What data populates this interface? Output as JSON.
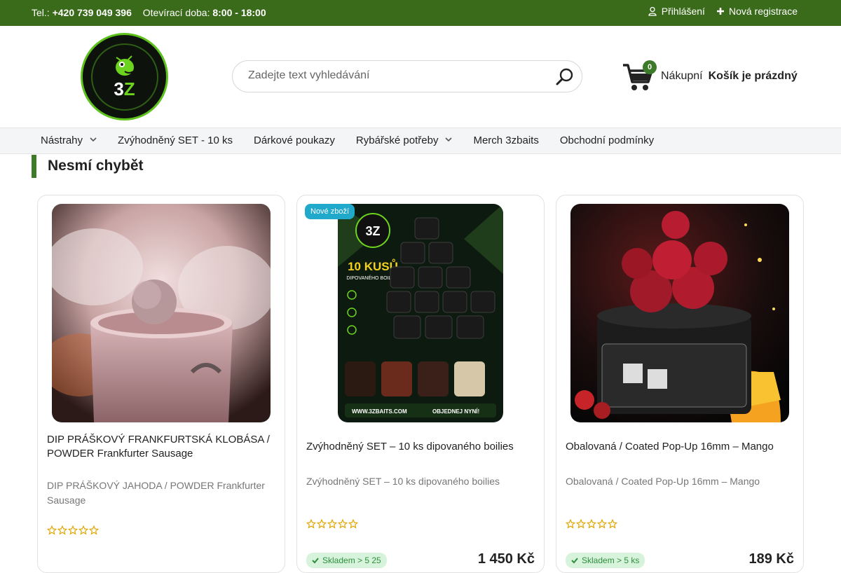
{
  "topbar": {
    "phone_label": "Tel.:",
    "phone": "+420 739 049 396",
    "hours_label": "Otevírací doba:",
    "hours": "8:00 - 18:00",
    "login": "Přihlášení",
    "register": "Nová registrace"
  },
  "header": {
    "logo_text_prefix": "3",
    "logo_text_accent": "Z",
    "search_placeholder": "Zadejte text vyhledávání",
    "cart_count": "0",
    "cart_label": "Nákupní",
    "cart_status": "Košík je prázdný"
  },
  "nav": {
    "items": [
      {
        "label": "Nástrahy",
        "dropdown": true
      },
      {
        "label": "Zvýhodněný SET - 10 ks",
        "dropdown": false
      },
      {
        "label": "Dárkové poukazy",
        "dropdown": false
      },
      {
        "label": "Rybářské potřeby",
        "dropdown": true
      },
      {
        "label": "Merch 3zbaits",
        "dropdown": false
      },
      {
        "label": "Obchodní podmínky",
        "dropdown": false
      }
    ]
  },
  "section": {
    "title": "Nesmí chybět"
  },
  "products": [
    {
      "title": "DIP PRÁŠKOVÝ FRANKFURTSKÁ KLOBÁSA / POWDER Frankfurter Sausage",
      "desc": "DIP PRÁŠKOVÝ JAHODA / POWDER Frankfurter Sausage",
      "badge": "",
      "stock": "",
      "price": "",
      "rating": 0
    },
    {
      "title": "Zvýhodněný SET – 10 ks dipovaného boilies",
      "desc": "Zvýhodněný SET – 10 ks dipovaného boilies",
      "badge": "Nové zboží",
      "stock": "Skladem > 5 25",
      "price": "1 450 Kč",
      "rating": 0,
      "poster_headline": "10 KUSŮ",
      "poster_sub": "DIPOVANÉHO BOILIES",
      "poster_url": "WWW.3ZBAITS.COM",
      "poster_cta": "OBJEDNEJ NYNÍ!"
    },
    {
      "title": "Obalovaná / Coated Pop-Up 16mm – Mango",
      "desc": "Obalovaná / Coated Pop-Up 16mm – Mango",
      "badge": "",
      "stock": "Skladem > 5 ks",
      "price": "189 Kč",
      "rating": 0
    }
  ],
  "colors": {
    "topbar_bg": "#3a6b1a",
    "accent_green": "#3d7a2a",
    "badge_new": "#21a9cc",
    "stock_bg": "#d7f3dc",
    "star": "#e0a500"
  }
}
